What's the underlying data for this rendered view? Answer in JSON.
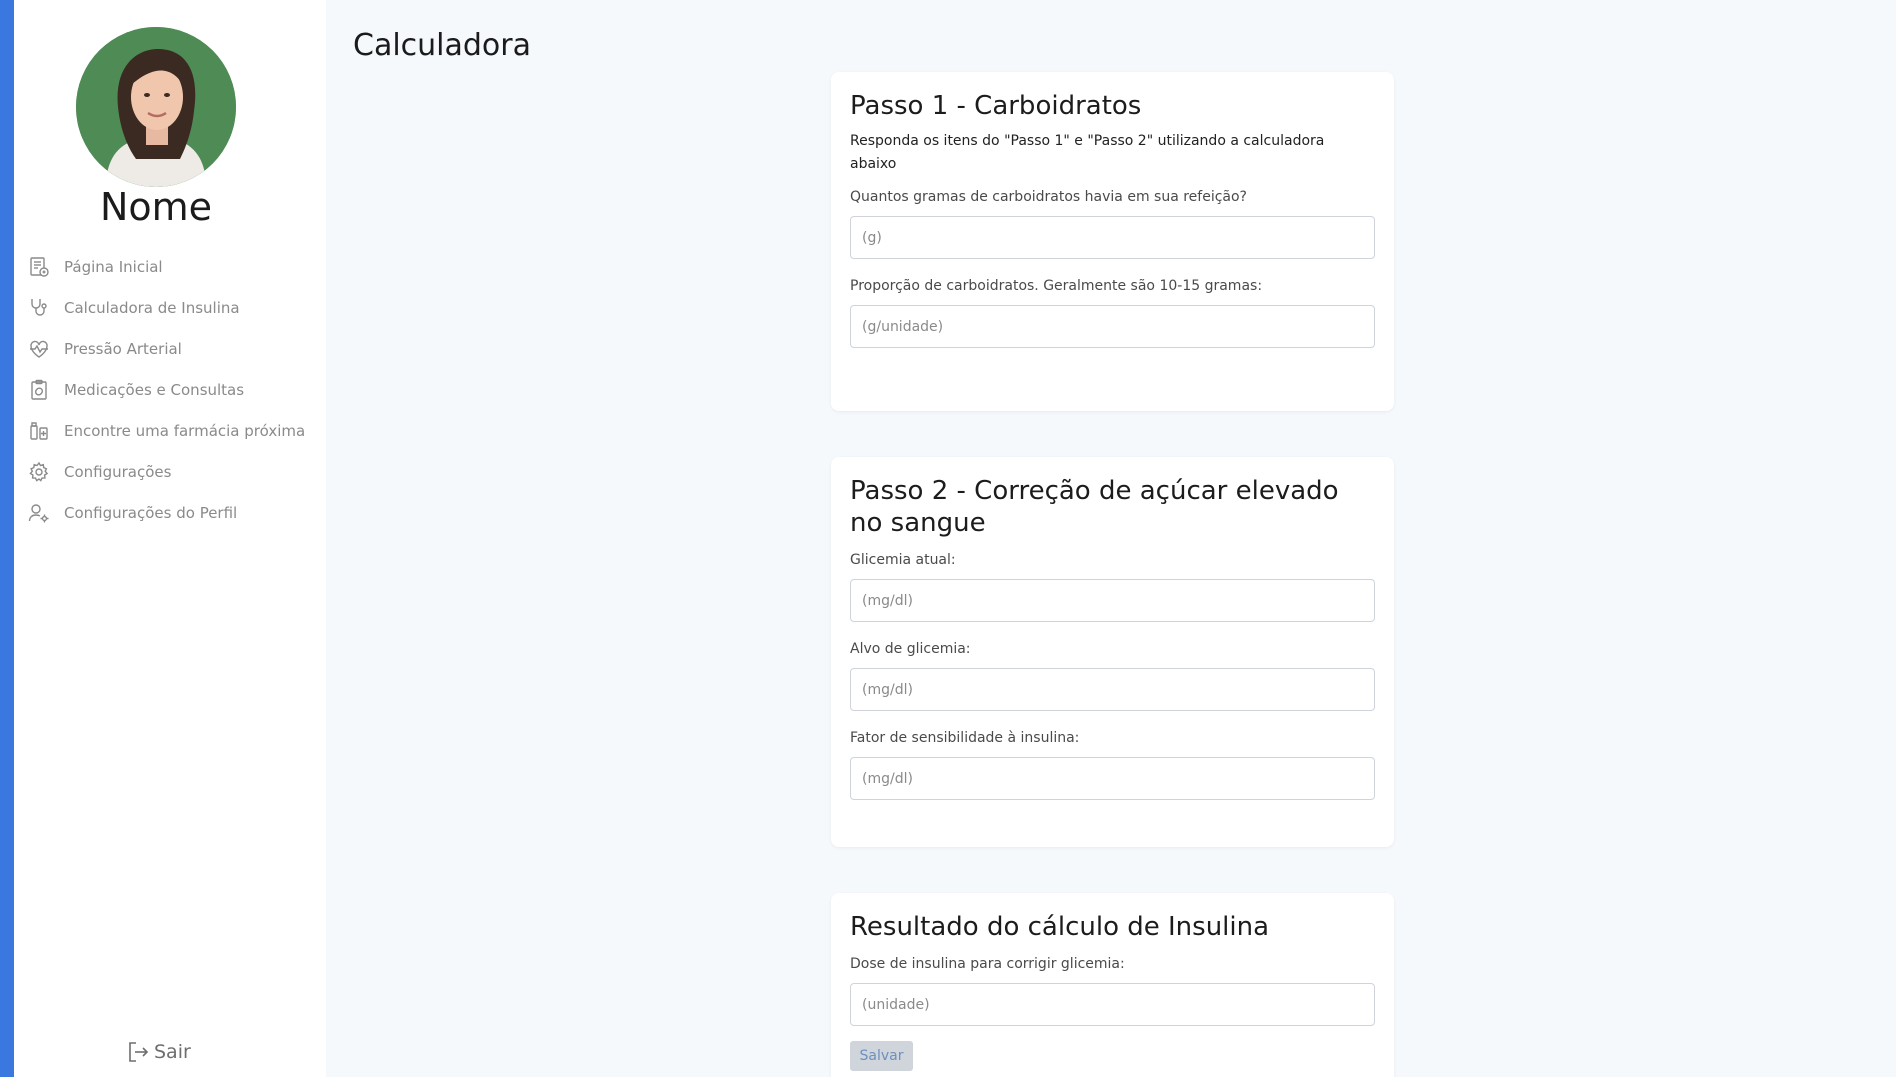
{
  "colors": {
    "accent": "#3a78e0",
    "sidebar_bg": "#ffffff",
    "page_bg": "#f5f9fc"
  },
  "sidebar": {
    "profile_name": "Nome",
    "items": [
      {
        "label": "Página Inicial",
        "icon": "home-document-icon"
      },
      {
        "label": "Calculadora de Insulina",
        "icon": "stethoscope-icon"
      },
      {
        "label": "Pressão Arterial",
        "icon": "heart-pulse-icon"
      },
      {
        "label": "Medicações e Consultas",
        "icon": "clipboard-pill-icon"
      },
      {
        "label": "Encontre uma farmácia próxima",
        "icon": "pharmacy-icon"
      },
      {
        "label": "Configurações",
        "icon": "gear-icon"
      },
      {
        "label": "Configurações do Perfil",
        "icon": "user-gear-icon"
      }
    ],
    "logout_label": "Sair"
  },
  "main": {
    "title": "Calculadora",
    "step1": {
      "title": "Passo 1 - Carboidratos",
      "description": "Responda os itens do \"Passo 1\" e \"Passo 2\" utilizando a calculadora abaixo",
      "carbs_label": "Quantos gramas de carboidratos havia em sua refeição?",
      "carbs_placeholder": "(g)",
      "ratio_label": "Proporção de carboidratos. Geralmente são 10-15 gramas:",
      "ratio_placeholder": "(g/unidade)"
    },
    "step2": {
      "title": "Passo 2 - Correção de açúcar elevado no sangue",
      "current_label": "Glicemia atual:",
      "current_placeholder": "(mg/dl)",
      "target_label": "Alvo de glicemia:",
      "target_placeholder": "(mg/dl)",
      "sensitivity_label": "Fator de sensibilidade à insulina:",
      "sensitivity_placeholder": "(mg/dl)"
    },
    "result": {
      "title": "Resultado do cálculo de Insulina",
      "dose_label": "Dose de insulina para corrigir glicemia:",
      "dose_placeholder": "(unidade)",
      "save_label": "Salvar"
    }
  }
}
